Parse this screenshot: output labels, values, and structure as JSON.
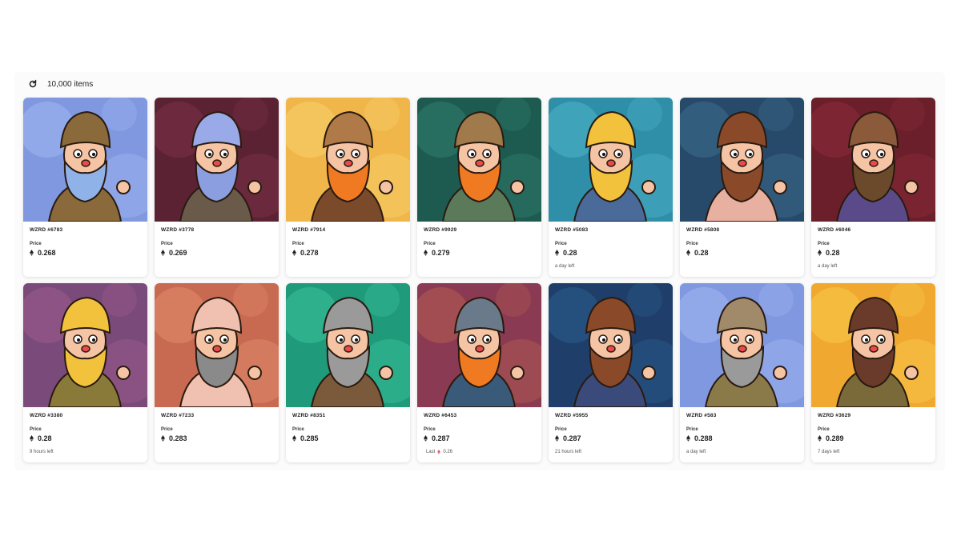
{
  "toolbar": {
    "item_count": "10,000 items"
  },
  "labels": {
    "price": "Price",
    "last": "Last"
  },
  "items": [
    {
      "name": "WZRD #6783",
      "price": "0.268",
      "footer": "",
      "last": "",
      "bg": "#7f98e0",
      "bg2": "#9db2ef",
      "hair": "#8aa3d8",
      "beard": "#8fb3e8",
      "hat": "#8a6a3a",
      "cloth": "#8a6a3a"
    },
    {
      "name": "WZRD #3778",
      "price": "0.269",
      "footer": "",
      "last": "",
      "bg": "#5b2233",
      "bg2": "#7a3048",
      "hair": "#9aaae8",
      "beard": "#8b9ee0",
      "hat": "#9aaae8",
      "cloth": "#6a5a4a"
    },
    {
      "name": "WZRD #7914",
      "price": "0.278",
      "footer": "",
      "last": "",
      "bg": "#f0b64a",
      "bg2": "#f6cf6a",
      "hair": "#b07a48",
      "beard": "#f07a22",
      "hat": "#b07a48",
      "cloth": "#7a4a2a"
    },
    {
      "name": "WZRD #9929",
      "price": "0.279",
      "footer": "",
      "last": "",
      "bg": "#1d5b50",
      "bg2": "#2e7a6a",
      "hair": "#e8a040",
      "beard": "#f07a22",
      "hat": "#a07a4a",
      "cloth": "#5a7a5a"
    },
    {
      "name": "WZRD #5083",
      "price": "0.28",
      "footer": "a day left",
      "last": "",
      "bg": "#2f8fa8",
      "bg2": "#4bb0c6",
      "hair": "#f2c23c",
      "beard": "#f2c23c",
      "hat": "#f2c23c",
      "cloth": "#4a6a9a"
    },
    {
      "name": "WZRD #5808",
      "price": "0.28",
      "footer": "",
      "last": "",
      "bg": "#284a6a",
      "bg2": "#3a6a8a",
      "hair": "#8a4a2a",
      "beard": "#8a4a2a",
      "hat": "#8a4a2a",
      "cloth": "#e8b0a0"
    },
    {
      "name": "WZRD #6046",
      "price": "0.28",
      "footer": "a day left",
      "last": "",
      "bg": "#6a1f2a",
      "bg2": "#8a2a3a",
      "hair": "#8a5a3a",
      "beard": "#6a4a2a",
      "hat": "#8a5a3a",
      "cloth": "#5a4a8a"
    },
    {
      "name": "WZRD #3380",
      "price": "0.28",
      "footer": "9 hours left",
      "last": "",
      "bg": "#7a4a7a",
      "bg2": "#9a5a8a",
      "hair": "#f2c23c",
      "beard": "#f2c23c",
      "hat": "#f2c23c",
      "cloth": "#8a7a3a"
    },
    {
      "name": "WZRD #7233",
      "price": "0.283",
      "footer": "",
      "last": "",
      "bg": "#c86a52",
      "bg2": "#e08a6a",
      "hair": "#f0c0b0",
      "beard": "#8a8a8a",
      "hat": "#f0c0b0",
      "cloth": "#f0c0b0"
    },
    {
      "name": "WZRD #8351",
      "price": "0.285",
      "footer": "",
      "last": "",
      "bg": "#1f9a7a",
      "bg2": "#3ac09a",
      "hair": "#9a9a9a",
      "beard": "#9a9a9a",
      "hat": "#9a9a9a",
      "cloth": "#7a5a3a"
    },
    {
      "name": "WZRD #6453",
      "price": "0.287",
      "footer": "",
      "last": "0.26",
      "bg": "#8a3a52",
      "bg2": "#b05a52",
      "hair": "#8a6a3a",
      "beard": "#f07a22",
      "hat": "#6a7a8a",
      "cloth": "#3a5a7a"
    },
    {
      "name": "WZRD #5955",
      "price": "0.287",
      "footer": "21 hours left",
      "last": "",
      "bg": "#1f3f6a",
      "bg2": "#2a5a8a",
      "hair": "#8a4a2a",
      "beard": "#8a4a2a",
      "hat": "#8a4a2a",
      "cloth": "#3a4a7a"
    },
    {
      "name": "WZRD #583",
      "price": "0.288",
      "footer": "a day left",
      "last": "",
      "bg": "#7f98e0",
      "bg2": "#9db2ef",
      "hair": "#9a9a9a",
      "beard": "#9a9a9a",
      "hat": "#a08a6a",
      "cloth": "#8a7a4a"
    },
    {
      "name": "WZRD #3629",
      "price": "0.289",
      "footer": "7 days left",
      "last": "",
      "bg": "#f0a830",
      "bg2": "#f6c84a",
      "hair": "#6a3a2a",
      "beard": "#6a3a2a",
      "hat": "#6a3a2a",
      "cloth": "#7a6a3a"
    }
  ]
}
